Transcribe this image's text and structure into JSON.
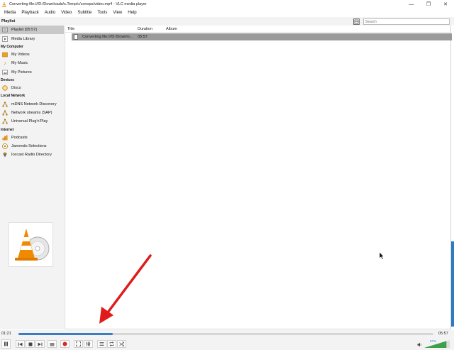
{
  "window": {
    "title": "Converting file:///D:/Downloads/s.Temp/c/conops/video.mp4 - VLC media player",
    "minimize_glyph": "—",
    "maximize_glyph": "❐",
    "close_glyph": "✕"
  },
  "menu": [
    "Media",
    "Playback",
    "Audio",
    "Video",
    "Subtitle",
    "Tools",
    "View",
    "Help"
  ],
  "playlist_header": {
    "title": "Playlist",
    "search_placeholder": "Search"
  },
  "sidebar": {
    "sections": [
      {
        "label": "",
        "items": [
          {
            "label": "Playlist [05:57]",
            "icon": "playlist-icon",
            "selected": true
          },
          {
            "label": "Media Library",
            "icon": "media-library-icon"
          }
        ]
      },
      {
        "label": "My Computer",
        "items": [
          {
            "label": "My Videos",
            "icon": "videos-icon"
          },
          {
            "label": "My Music",
            "icon": "music-icon"
          },
          {
            "label": "My Pictures",
            "icon": "pictures-icon"
          }
        ]
      },
      {
        "label": "Devices",
        "items": [
          {
            "label": "Discs",
            "icon": "disc-icon"
          }
        ]
      },
      {
        "label": "Local Network",
        "items": [
          {
            "label": "mDNS Network Discovery",
            "icon": "network-icon"
          },
          {
            "label": "Network streams (SAP)",
            "icon": "network-icon"
          },
          {
            "label": "Universal Plug'n'Play",
            "icon": "network-icon"
          }
        ]
      },
      {
        "label": "Internet",
        "items": [
          {
            "label": "Podcasts",
            "icon": "podcast-icon"
          },
          {
            "label": "Jamendo Selections",
            "icon": "jamendo-icon"
          },
          {
            "label": "Icecast Radio Directory",
            "icon": "icecast-icon"
          }
        ]
      }
    ]
  },
  "columns": {
    "title": "Title",
    "duration": "Duration",
    "album": "Album"
  },
  "rows": [
    {
      "title": "Converting file:///D:/Downlo...",
      "duration": "05:57",
      "album": ""
    }
  ],
  "playback": {
    "elapsed": "01:21",
    "total": "05:57",
    "progress_fraction": 0.227,
    "volume_label": "87%",
    "volume_fraction": 0.87
  },
  "colors": {
    "accent": "#3a7dc4",
    "selected_row": "#9b9b9b",
    "vlc_orange": "#f08a00",
    "record_red": "#d62828",
    "annotation_arrow": "#e01b1b"
  },
  "icons": {
    "app": "vlc-cone-icon",
    "view_toggle": "view-toggle-icon"
  }
}
